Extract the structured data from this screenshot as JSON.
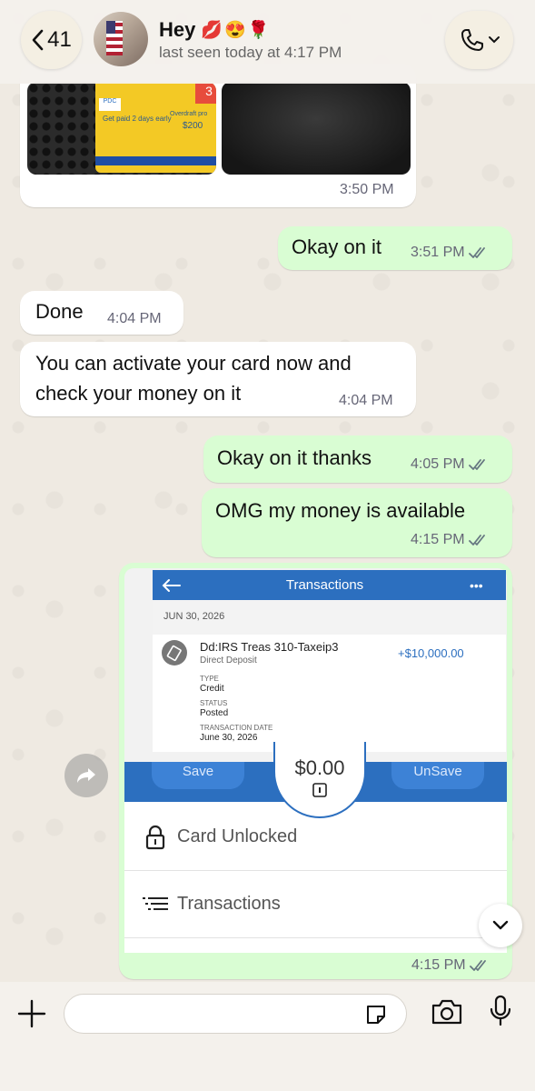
{
  "header": {
    "back_count": "41",
    "contact_name": "Hey",
    "contact_emojis": "💋😍🌹",
    "last_seen": "last seen today at 4:17 PM"
  },
  "messages": [
    {
      "id": "m0",
      "direction": "in",
      "type": "image",
      "time": "3:50 PM"
    },
    {
      "id": "m1",
      "direction": "out",
      "text": "Okay on it",
      "time": "3:51 PM",
      "status": "read"
    },
    {
      "id": "m2",
      "direction": "in",
      "text": "Done",
      "time": "4:04 PM"
    },
    {
      "id": "m3",
      "direction": "in",
      "text_lines": [
        "You can activate your card now and",
        "check your money on it"
      ],
      "time": "4:04 PM"
    },
    {
      "id": "m4",
      "direction": "out",
      "text": "Okay on it thanks",
      "time": "4:05 PM",
      "status": "read"
    },
    {
      "id": "m5",
      "direction": "out",
      "text": "OMG my money is available",
      "time": "4:15 PM",
      "status": "read"
    },
    {
      "id": "m6",
      "direction": "out",
      "type": "image",
      "time": "4:15 PM",
      "status": "read"
    }
  ],
  "card_image_text": {
    "brand": "PDC",
    "paid_early": "Get paid 2 days early",
    "overdraft": "Overdraft pro",
    "overdraft_amount": "$200",
    "badge": "3"
  },
  "screenshot": {
    "title": "Transactions",
    "menu": "•••",
    "date_header": "JUN 30, 2026",
    "txn_name": "Dd:IRS  Treas 310-Taxeip3",
    "txn_sub": "Direct Deposit",
    "txn_amount": "+$10,000.00",
    "type_label": "TYPE",
    "type_value": "Credit",
    "status_label": "STATUS",
    "status_value": "Posted",
    "date_label": "TRANSACTION DATE",
    "date_value": "June 30, 2026"
  },
  "card_screen": {
    "save": "Save",
    "balance": "$0.00",
    "unsave": "UnSave",
    "card_unlocked": "Card Unlocked",
    "transactions": "Transactions"
  },
  "colors": {
    "incoming": "#ffffff",
    "outgoing": "#d9fdd3",
    "bank_blue": "#2c6fbf",
    "read_ticks": "#667781"
  }
}
